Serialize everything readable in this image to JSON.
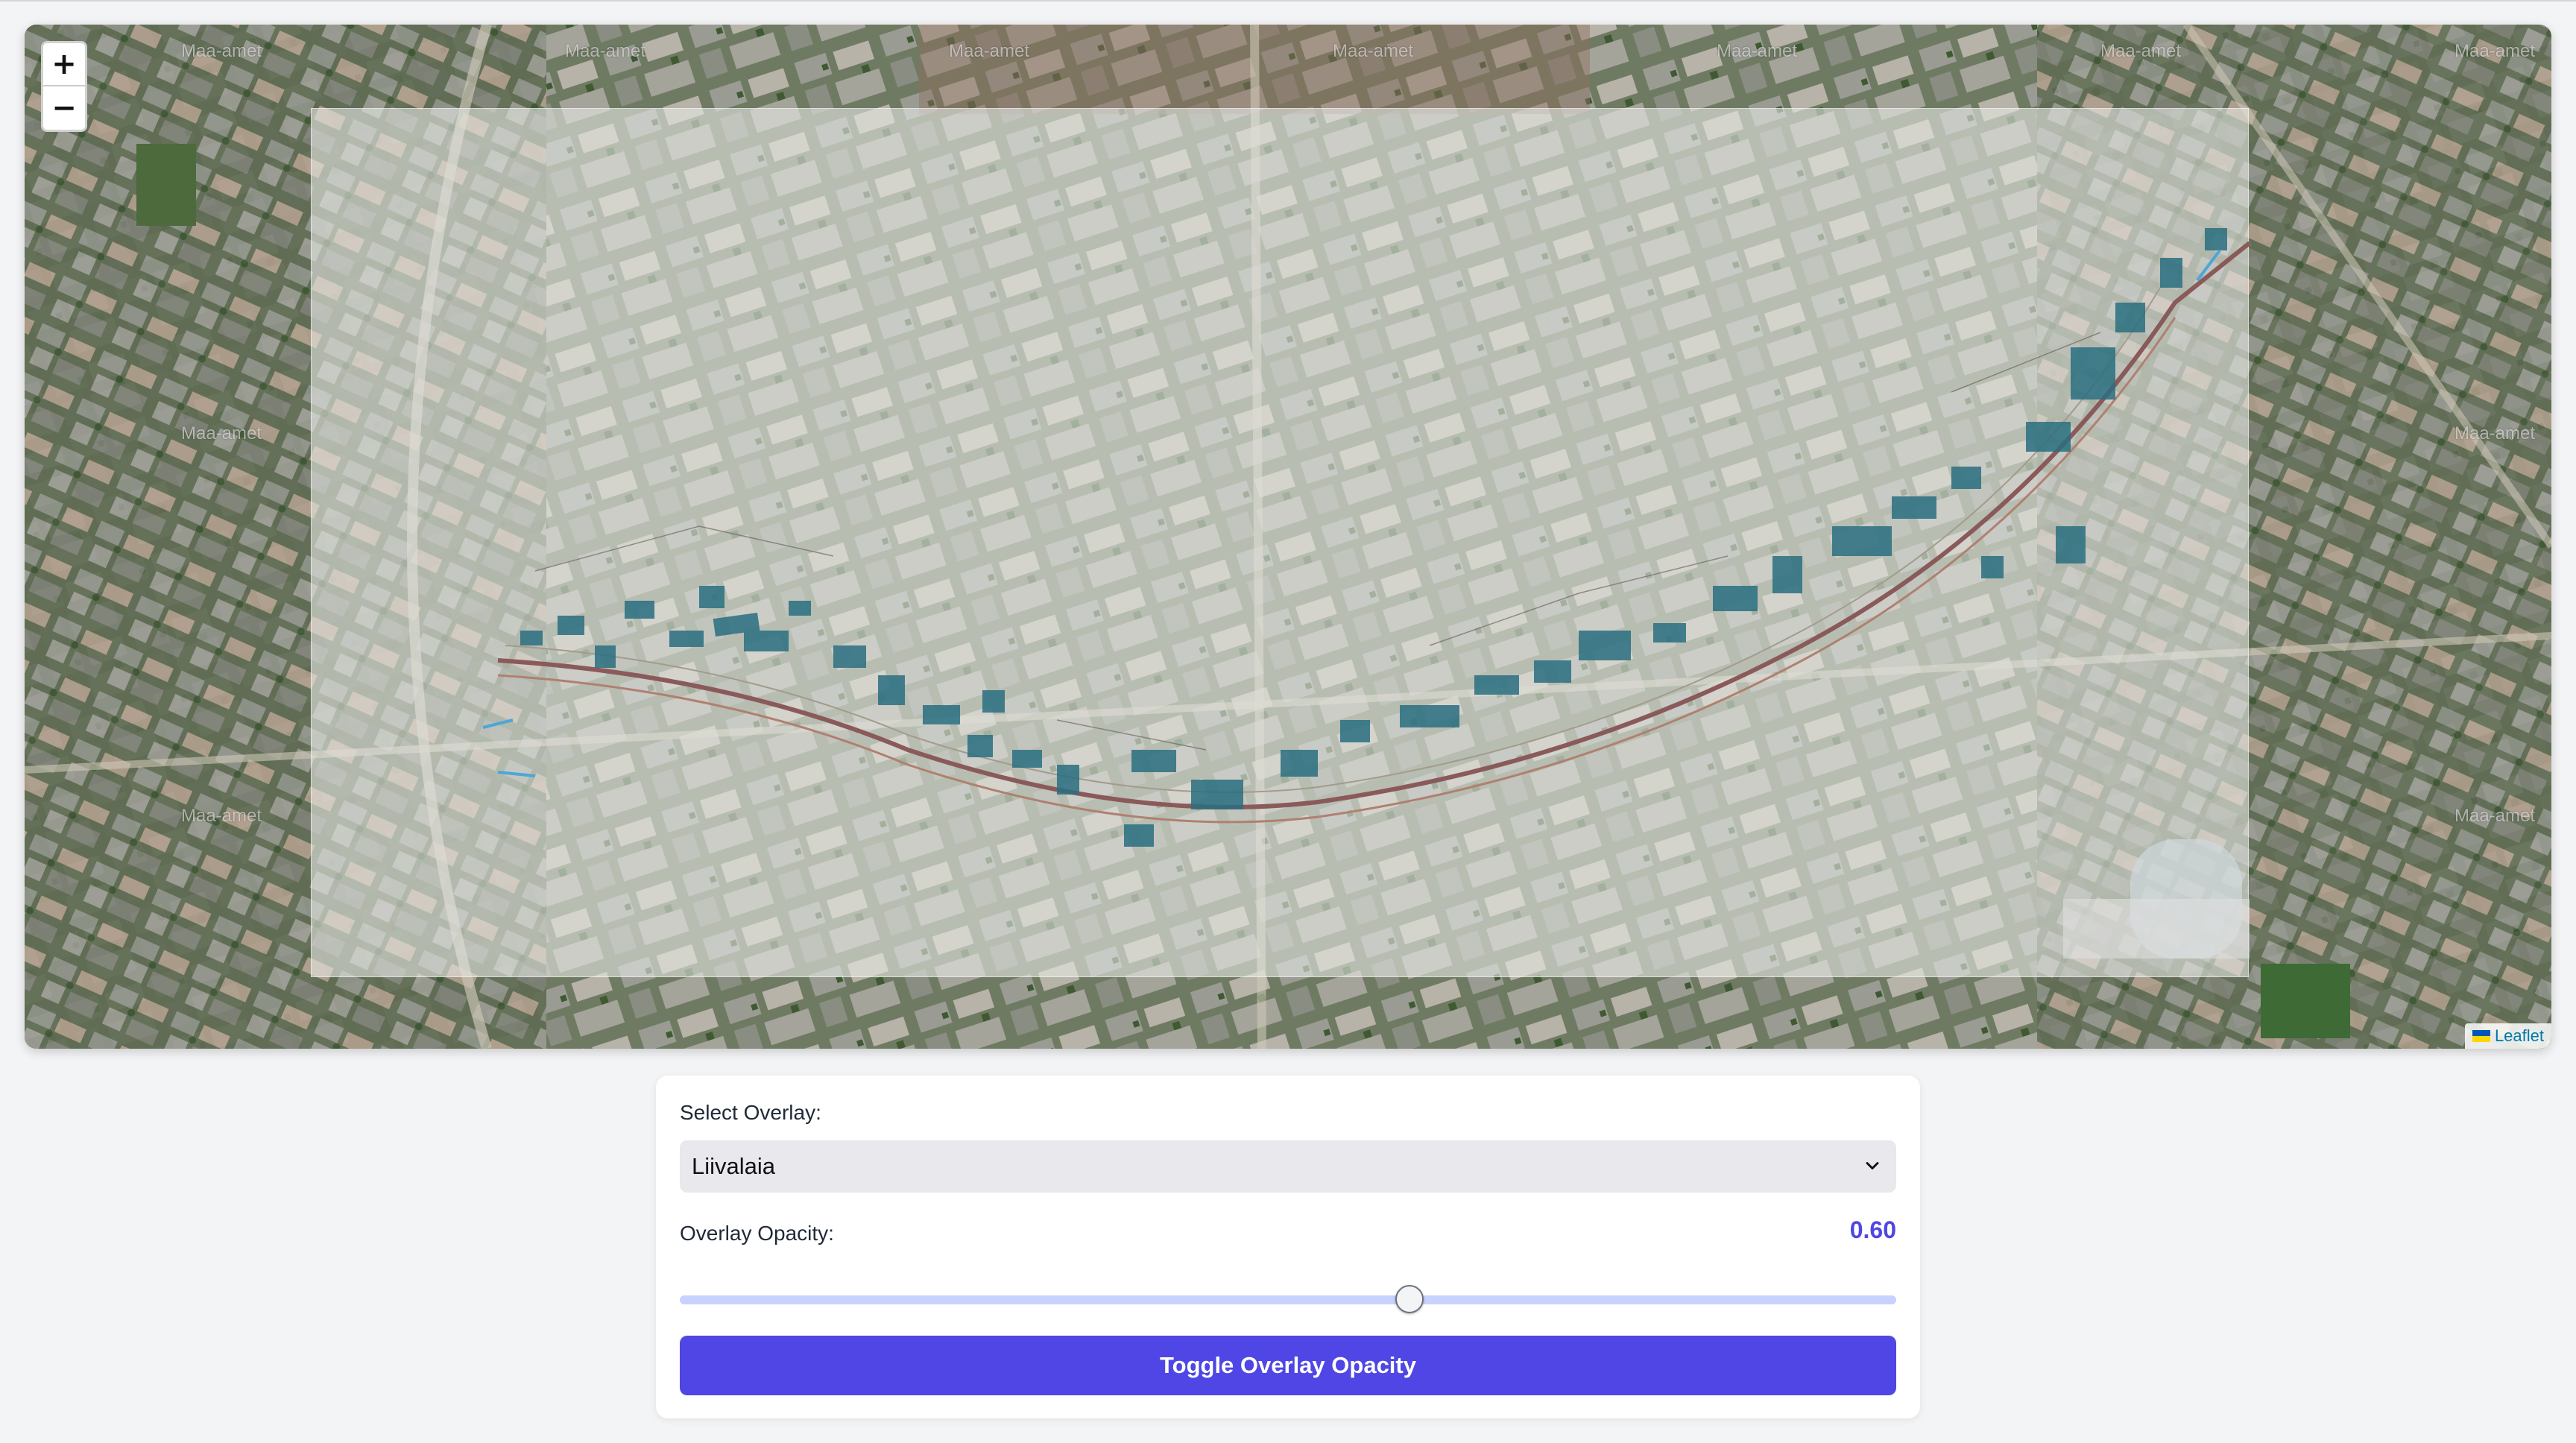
{
  "map": {
    "zoom_in_label": "+",
    "zoom_out_label": "−",
    "watermark_text": "Maa-amet",
    "attribution_label": "Leaflet",
    "overlay_highlight_color": "#2a6f80",
    "route_color": "#8a5a5a"
  },
  "controls": {
    "select_label": "Select Overlay:",
    "selected_overlay": "Liivalaia",
    "opacity_label": "Overlay Opacity:",
    "opacity_value": "0.60",
    "opacity_fraction": 0.6,
    "toggle_button_label": "Toggle Overlay Opacity",
    "accent_color": "#4f46e5"
  }
}
